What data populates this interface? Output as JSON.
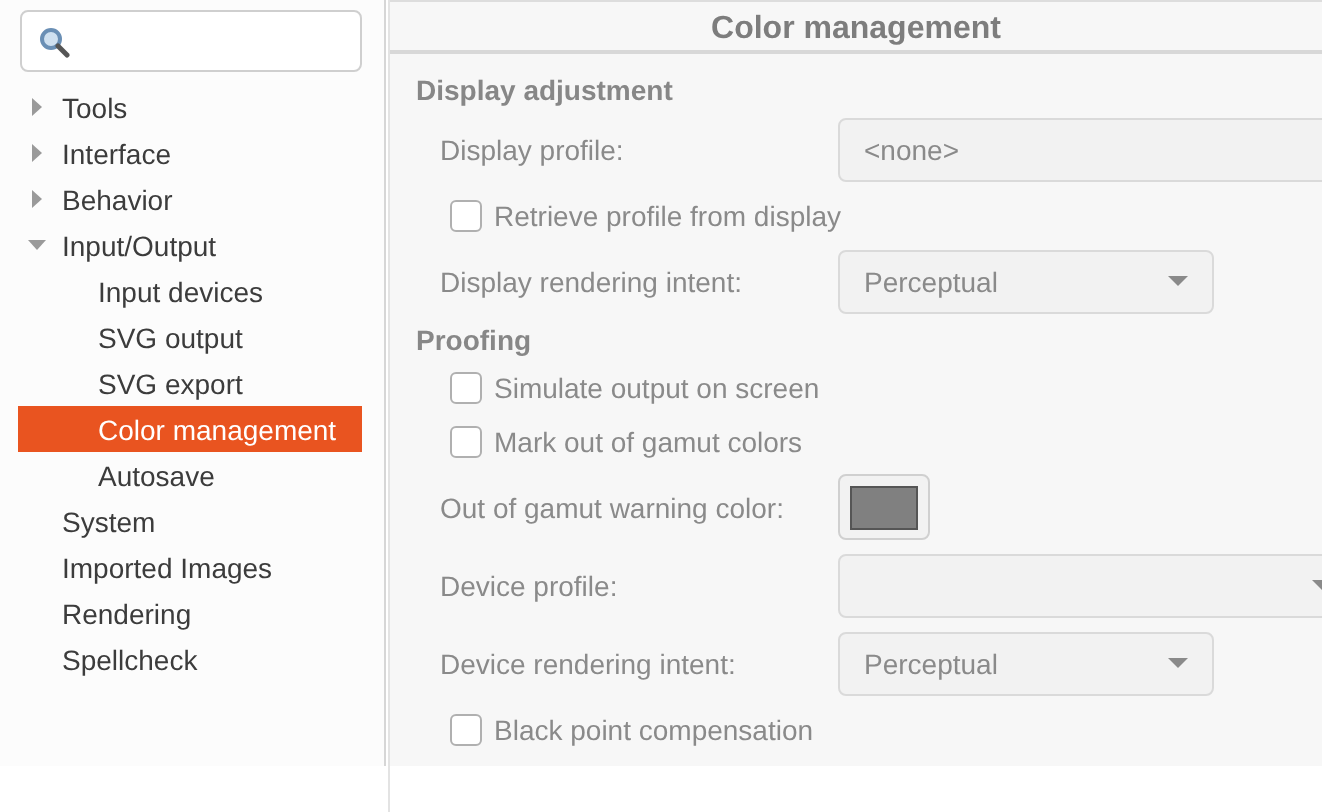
{
  "tree": [
    {
      "label": "Tools",
      "kind": "branch",
      "expanded": false,
      "selected": false
    },
    {
      "label": "Interface",
      "kind": "branch",
      "expanded": false,
      "selected": false
    },
    {
      "label": "Behavior",
      "kind": "branch",
      "expanded": false,
      "selected": false
    },
    {
      "label": "Input/Output",
      "kind": "branch",
      "expanded": true,
      "selected": false,
      "children": [
        {
          "label": "Input devices",
          "selected": false
        },
        {
          "label": "SVG output",
          "selected": false
        },
        {
          "label": "SVG export",
          "selected": false
        },
        {
          "label": "Color management",
          "selected": true
        },
        {
          "label": "Autosave",
          "selected": false
        }
      ]
    },
    {
      "label": "System",
      "kind": "leaf",
      "selected": false
    },
    {
      "label": "Imported Images",
      "kind": "leaf",
      "selected": false
    },
    {
      "label": "Rendering",
      "kind": "leaf",
      "selected": false
    },
    {
      "label": "Spellcheck",
      "kind": "leaf",
      "selected": false
    }
  ],
  "page": {
    "title": "Color management",
    "rows": [
      {
        "kind": "heading",
        "label": "Display adjustment"
      },
      {
        "kind": "combo",
        "label": "Display profile:",
        "value": "<none>",
        "wide": true,
        "arrow": false
      },
      {
        "kind": "checkbox",
        "label": "Retrieve profile from display",
        "checked": false
      },
      {
        "kind": "combo",
        "label": "Display rendering intent:",
        "value": "Perceptual",
        "wide": false,
        "arrow": true
      },
      {
        "kind": "heading",
        "label": "Proofing"
      },
      {
        "kind": "checkbox",
        "label": "Simulate output on screen",
        "checked": false
      },
      {
        "kind": "checkbox",
        "label": "Mark out of gamut colors",
        "checked": false
      },
      {
        "kind": "color",
        "label": "Out of gamut warning color:",
        "color": "#808080"
      },
      {
        "kind": "combo",
        "label": "Device profile:",
        "value": "",
        "wide": true,
        "arrow": true
      },
      {
        "kind": "combo",
        "label": "Device rendering intent:",
        "value": "Perceptual",
        "wide": false,
        "arrow": true
      },
      {
        "kind": "checkbox",
        "label": "Black point compensation",
        "checked": false
      }
    ]
  }
}
